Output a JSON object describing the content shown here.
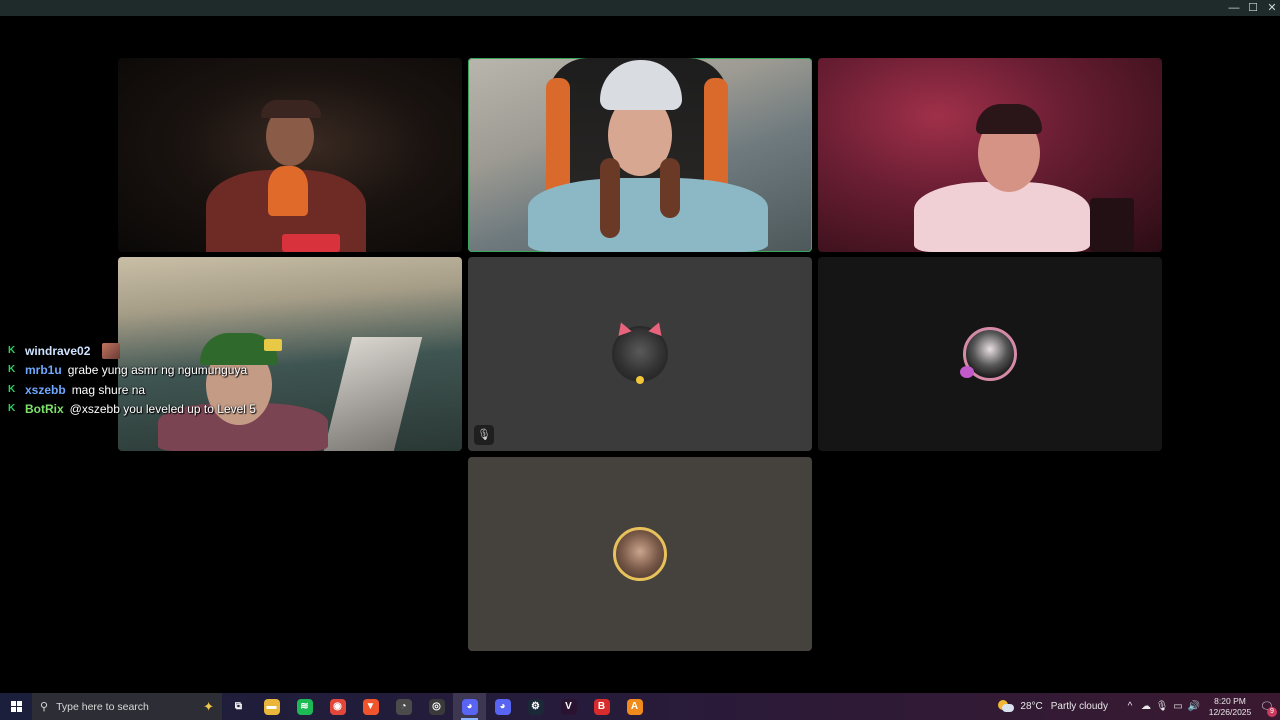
{
  "window": {
    "minimize_glyph": "—",
    "maximize_glyph": "☐",
    "close_glyph": "✕"
  },
  "call": {
    "tiles": [
      {
        "name": "participant-1",
        "speaking": false,
        "video": true
      },
      {
        "name": "participant-2",
        "speaking": true,
        "video": true
      },
      {
        "name": "participant-3",
        "speaking": false,
        "video": true
      },
      {
        "name": "participant-4",
        "speaking": false,
        "video": true
      },
      {
        "name": "participant-5",
        "speaking": false,
        "video": false,
        "muted": true
      },
      {
        "name": "participant-6",
        "speaking": false,
        "video": false
      },
      {
        "name": "participant-7",
        "speaking": false,
        "video": false
      }
    ],
    "mute_glyph": "🎙"
  },
  "chat": {
    "badge_glyph": "K",
    "messages": [
      {
        "user": "windrave02",
        "color": "#cfe3ff",
        "text": "",
        "emote": true
      },
      {
        "user": "mrb1u",
        "color": "#6fa8ff",
        "text": "grabe yung asmr ng ngumunguya"
      },
      {
        "user": "xszebb",
        "color": "#6fa8ff",
        "text": "mag shure na"
      },
      {
        "user": "BotRix",
        "color": "#7ee26a",
        "text": "@xszebb you leveled up to Level 5"
      }
    ]
  },
  "taskbar": {
    "search_placeholder": "Type here to search",
    "search_glyph": "⚲",
    "sparkle_glyph": "✦",
    "apps": [
      {
        "name": "task-view-icon",
        "glyph": "⧉",
        "bg": "transparent",
        "active": false
      },
      {
        "name": "file-explorer-icon",
        "glyph": "▬",
        "bg": "#e9b53a",
        "active": false
      },
      {
        "name": "spotify-icon",
        "glyph": "≋",
        "bg": "#1db954",
        "active": false
      },
      {
        "name": "chrome-icon",
        "glyph": "◉",
        "bg": "#e2473b",
        "active": false
      },
      {
        "name": "brave-icon",
        "glyph": "▼",
        "bg": "#f0542c",
        "active": false
      },
      {
        "name": "speedometer-icon",
        "glyph": "◔",
        "bg": "#4b4b4b",
        "active": false
      },
      {
        "name": "obs-icon",
        "glyph": "◎",
        "bg": "#3a3a3a",
        "active": false
      },
      {
        "name": "discord-active-icon",
        "glyph": "◕",
        "bg": "#5865f2",
        "active": true
      },
      {
        "name": "discord-icon",
        "glyph": "◕",
        "bg": "#5865f2",
        "active": false
      },
      {
        "name": "steam-icon",
        "glyph": "⚙",
        "bg": "#1b2838",
        "active": false
      },
      {
        "name": "vegas-icon",
        "glyph": "V",
        "bg": "#2a1330",
        "active": false
      },
      {
        "name": "bitdefender-icon",
        "glyph": "B",
        "bg": "#d82c2c",
        "active": false
      },
      {
        "name": "archisoft-icon",
        "glyph": "A",
        "bg": "#f08a1d",
        "active": false
      }
    ],
    "weather": {
      "temp": "28°C",
      "condition": "Partly cloudy"
    },
    "tray_icons": [
      {
        "name": "chevron-up-icon",
        "glyph": "^"
      },
      {
        "name": "network-cloud-icon",
        "glyph": "☁"
      },
      {
        "name": "microphone-icon",
        "glyph": "🎙"
      },
      {
        "name": "monitor-icon",
        "glyph": "▭"
      },
      {
        "name": "volume-icon",
        "glyph": "🔊"
      }
    ],
    "time": "8:20 PM",
    "date": "12/26/2025",
    "notification_glyph": "🗨",
    "notification_count": "9"
  }
}
